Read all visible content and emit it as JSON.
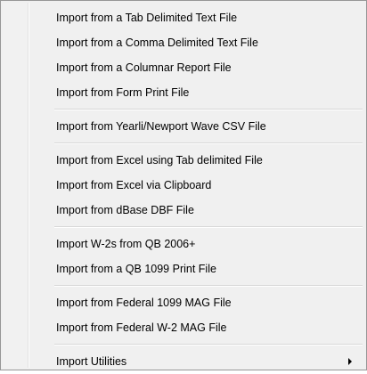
{
  "menu": {
    "items": [
      {
        "label": "Import from a Tab Delimited Text File"
      },
      {
        "label": "Import from a Comma Delimited Text File"
      },
      {
        "label": "Import from a Columnar Report File"
      },
      {
        "label": "Import from Form Print File"
      },
      {
        "label": "Import from Yearli/Newport Wave CSV File"
      },
      {
        "label": "Import from Excel using Tab delimited File"
      },
      {
        "label": "Import from Excel via Clipboard"
      },
      {
        "label": "Import from dBase DBF File"
      },
      {
        "label": "Import W-2s from QB 2006+"
      },
      {
        "label": "Import from a QB 1099 Print File"
      },
      {
        "label": "Import from Federal 1099 MAG File"
      },
      {
        "label": "Import from Federal W-2  MAG File"
      },
      {
        "label": "Import Utilities",
        "submenu_icon": "chevron-right-icon"
      }
    ]
  }
}
